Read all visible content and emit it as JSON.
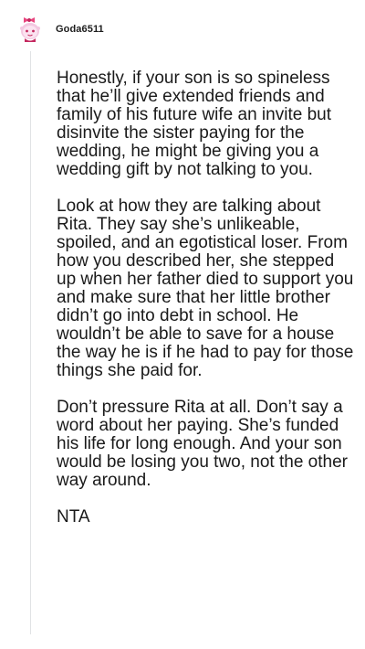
{
  "comment": {
    "username": "Goda6511",
    "avatar": "snoo-avatar-pink-bow-icon",
    "accent_color": "#ea0027",
    "paragraphs": [
      "Honestly, if your son is so spineless that he’ll give extended friends and family of his future wife an invite but disinvite the sister paying for the wedding, he might be giving you a wedding gift by not talking to you.",
      "Look at how they are talking about Rita. They say she’s unlikeable, spoiled, and an egotistical loser. From how you described her, she stepped up when her father died to support you and make sure that her little brother didn’t go into debt in school. He wouldn’t be able to save for a house the way he is if he had to pay for those things she paid for.",
      "Don’t pressure Rita at all. Don’t say a word about her paying. She’s funded his life for long enough. And your son would be losing you two, not the other way around.",
      "NTA"
    ]
  }
}
